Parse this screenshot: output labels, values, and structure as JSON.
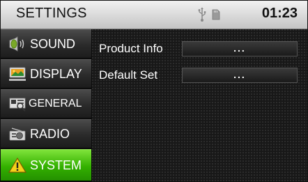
{
  "header": {
    "title": "SETTINGS",
    "time": "01:23",
    "status_icons": [
      "usb-icon",
      "sd-card-icon"
    ]
  },
  "sidebar": {
    "items": [
      {
        "label": "SOUND",
        "icon": "speaker-icon",
        "active": false
      },
      {
        "label": "DISPLAY",
        "icon": "display-icon",
        "active": false
      },
      {
        "label": "GENERAL",
        "icon": "general-icon",
        "active": false
      },
      {
        "label": "RADIO",
        "icon": "radio-icon",
        "active": false
      },
      {
        "label": "SYSTEM",
        "icon": "warning-icon",
        "active": true
      }
    ]
  },
  "system": {
    "rows": [
      {
        "label": "Product Info",
        "value": "..."
      },
      {
        "label": "Default Set",
        "value": "..."
      }
    ]
  },
  "colors": {
    "active_tab": "#33b000",
    "header_bg": "#d8d8d8",
    "panel_bg": "#181818"
  }
}
